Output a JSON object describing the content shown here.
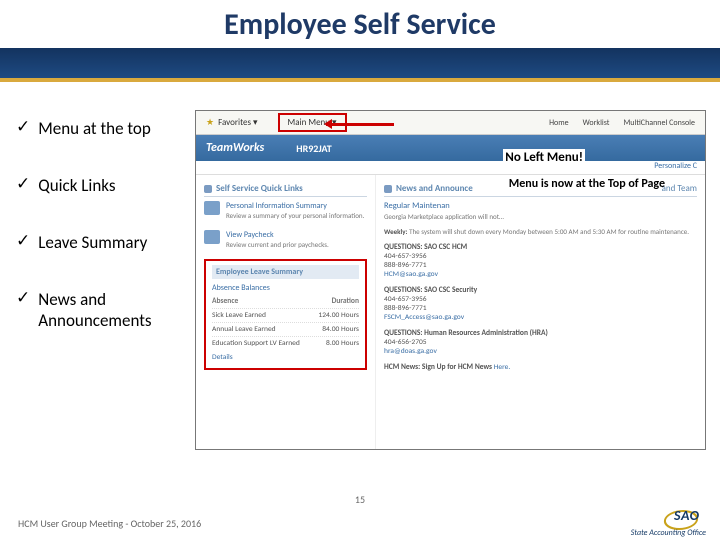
{
  "title": "Employee Self Service",
  "bullets": [
    "Menu at the top",
    "Quick Links",
    "Leave Summary",
    "News and Announcements"
  ],
  "screenshot": {
    "topnav": {
      "favorites": "Favorites",
      "main_menu": "Main Menu",
      "right_links": [
        "Home",
        "Worklist",
        "MultiChannel Console"
      ]
    },
    "brand": {
      "name": "TeamWorks",
      "user": "HR92JAT"
    },
    "personalize": "Personalize C",
    "callouts": {
      "no_left": "No Left Menu!",
      "menu_top": "Menu is now at the Top of Page"
    },
    "quick_links": {
      "header": "Self Service Quick Links",
      "items": [
        {
          "title": "Personal Information Summary",
          "sub": "Review a summary of your personal information."
        },
        {
          "title": "View Paycheck",
          "sub": "Review current and prior paychecks."
        }
      ]
    },
    "leave": {
      "header": "Employee Leave Summary",
      "subheader": "Absence Balances",
      "col_a": "Absence",
      "col_b": "Duration",
      "rows": [
        {
          "name": "Sick Leave Earned",
          "val": "124.00 Hours"
        },
        {
          "name": "Annual Leave Earned",
          "val": "84.00 Hours"
        },
        {
          "name": "Education Support LV Earned",
          "val": "8.00 Hours"
        }
      ],
      "details": "Details"
    },
    "news": {
      "header": "News and Announce",
      "maint_title": "Regular Maintenan",
      "maint_body1": "Georgia Marketplace application will not…",
      "weekly": "The system will shut down every Monday between 5:00 AM and 5:30 AM for routine maintenance.",
      "contacts": [
        {
          "label": "QUESTIONS: SAO CSC HCM",
          "lines": [
            "404-657-3956",
            "888-896-7771",
            "HCM@sao.ga.gov"
          ]
        },
        {
          "label": "QUESTIONS: SAO CSC Security",
          "lines": [
            "404-657-3956",
            "888-896-7771",
            "FSCM_Access@sao.ga.gov"
          ]
        },
        {
          "label": "QUESTIONS: Human Resources Administration (HRA)",
          "lines": [
            "404-656-2705",
            "hra@doas.ga.gov"
          ]
        }
      ],
      "hcm_news_pre": "HCM News: Sign Up for HCM News ",
      "hcm_news_link": "Here."
    },
    "right_panel_header": "and Team"
  },
  "footer": "HCM User Group Meeting - October 25, 2016",
  "slide_number": "15",
  "logo": {
    "acronym": "SAO",
    "full": "State Accounting Office"
  }
}
